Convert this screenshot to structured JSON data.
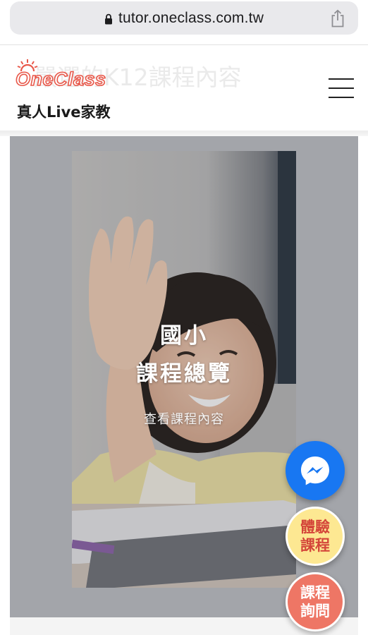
{
  "browser": {
    "url": "tutor.oneclass.com.tw",
    "icons": {
      "lock": "lock-icon",
      "share": "share-icon"
    }
  },
  "header": {
    "ghost_title": "嚴選的K12課程內容",
    "logo_text": "OneClass",
    "tagline": "真人Live家教",
    "menu_icon": "hamburger-icon"
  },
  "course_card": {
    "title_line1": "國小",
    "title_line2": "課程總覽",
    "link_label": "查看課程內容"
  },
  "floating_buttons": {
    "messenger_icon": "messenger-icon",
    "trial_label": "體驗課程",
    "inquiry_label": "課程詢問"
  },
  "colors": {
    "brand_red": "#e8584a",
    "messenger_blue": "#1877f2",
    "trial_yellow": "#fde892",
    "inquiry_coral": "#ee7665"
  }
}
